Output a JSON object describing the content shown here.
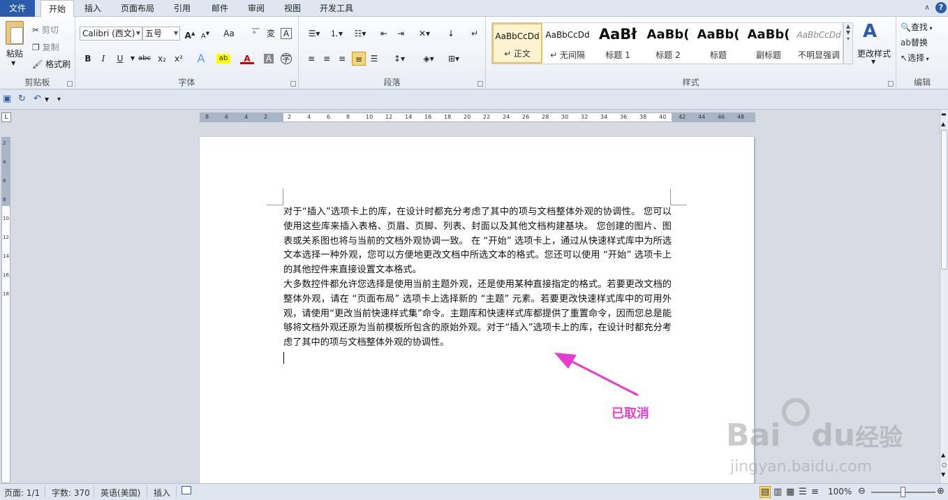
{
  "tabs": {
    "file": "文件",
    "items": [
      "开始",
      "插入",
      "页面布局",
      "引用",
      "邮件",
      "审阅",
      "视图",
      "开发工具"
    ],
    "active": 0
  },
  "ribbon": {
    "clipboard": {
      "paste": "粘贴",
      "cut": "剪切",
      "copy": "复制",
      "format_painter": "格式刷",
      "label": "剪贴板"
    },
    "font": {
      "font_name": "Calibri (西文)",
      "font_size": "五号",
      "label": "字体",
      "bold": "B",
      "italic": "I",
      "underline": "U",
      "strike": "abc",
      "sub": "x₂",
      "sup": "x²",
      "grow": "A",
      "shrink": "A",
      "case": "Aa",
      "clear": "A",
      "highlight": "ab",
      "color": "A"
    },
    "paragraph": {
      "label": "段落"
    },
    "styles": {
      "label": "样式",
      "items": [
        {
          "sample": "AaBbCcDd",
          "name": "↵ 正文"
        },
        {
          "sample": "AaBbCcDd",
          "name": "↵ 无间隔"
        },
        {
          "sample": "AaBł",
          "name": "标题 1"
        },
        {
          "sample": "AaBb(",
          "name": "标题 2"
        },
        {
          "sample": "AaBb(",
          "name": "标题"
        },
        {
          "sample": "AaBb(",
          "name": "副标题"
        },
        {
          "sample": "AaBbCcDd",
          "name": "不明显强调"
        }
      ],
      "change": "更改样式"
    },
    "editing": {
      "find": "查找",
      "replace": "替换",
      "select": "选择",
      "label": "编辑"
    }
  },
  "ruler": {
    "ticks": [
      "8",
      "6",
      "4",
      "2",
      "2",
      "4",
      "6",
      "8",
      "10",
      "12",
      "14",
      "16",
      "18",
      "20",
      "22",
      "24",
      "26",
      "28",
      "30",
      "32",
      "34",
      "36",
      "38",
      "40",
      "42",
      "44",
      "46",
      "48"
    ],
    "vticks": [
      "2",
      "4",
      "6",
      "8",
      "10",
      "12",
      "14",
      "16",
      "18"
    ]
  },
  "document": {
    "paragraphs": [
      "对于“插入”选项卡上的库，在设计时都充分考虑了其中的项与文档整体外观的协调性。 您可以使用这些库来插入表格、页眉、页脚、列表、封面以及其他文档构建基块。 您创建的图片、图表或关系图也将与当前的文档外观协调一致。 在 “开始” 选项卡上，通过从快速样式库中为所选文本选择一种外观，您可以方便地更改文档中所选文本的格式。您还可以使用 “开始” 选项卡上的其他控件来直接设置文本格式。",
      "大多数控件都允许您选择是使用当前主题外观，还是使用某种直接指定的格式。若要更改文档的整体外观，请在 “页面布局” 选项卡上选择新的 “主题” 元素。若要更改快速样式库中的可用外观，请使用“更改当前快速样式集”命令。主题库和快速样式库都提供了重置命令，因而您总是能够将文档外观还原为当前模板所包含的原始外观。对于“插入”选项卡上的库，在设计时都充分考虑了其中的项与文档整体外观的协调性。"
    ]
  },
  "annotation": {
    "text": "已取消",
    "color": "#e63ccf"
  },
  "status": {
    "page": "页面: 1/1",
    "words": "字数: 370",
    "lang": "英语(美国)",
    "mode": "插入",
    "zoom": "100%"
  },
  "watermark": {
    "brand": "Bai",
    "brand2": "du",
    "brand_cn": "经验",
    "url": "jingyan.baidu.com"
  },
  "colors": {
    "accent": "#2a5caa",
    "annotation": "#e63ccf"
  }
}
